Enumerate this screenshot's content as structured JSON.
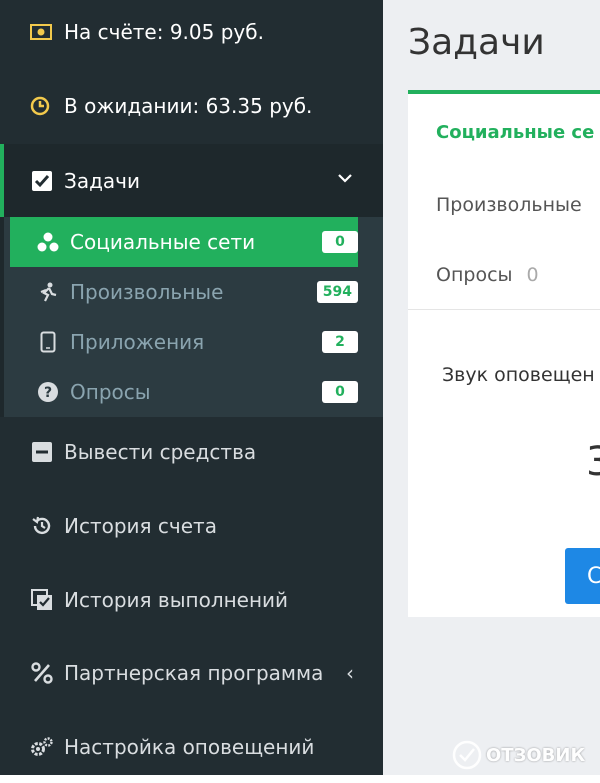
{
  "sidebar": {
    "balance": "На счёте: 9.05 руб.",
    "pending": "В ожидании: 63.35 руб.",
    "tasks_label": "Задачи",
    "submenu": [
      {
        "label": "Социальные сети",
        "badge": "0",
        "icon": "social-icon"
      },
      {
        "label": "Произвольные",
        "badge": "594",
        "icon": "custom-icon"
      },
      {
        "label": "Приложения",
        "badge": "2",
        "icon": "phone-icon"
      },
      {
        "label": "Опросы",
        "badge": "0",
        "icon": "question-icon"
      }
    ],
    "nav": [
      {
        "label": "Вывести средства",
        "icon": "minus-square-icon"
      },
      {
        "label": "История счета",
        "icon": "history-icon"
      },
      {
        "label": "История выполнений",
        "icon": "checked-list-icon"
      },
      {
        "label": "Партнерская программа",
        "icon": "percent-icon",
        "arrow": "‹"
      },
      {
        "label": "Настройка оповещений",
        "icon": "gears-icon"
      }
    ]
  },
  "main": {
    "title": "Задачи",
    "box_title": "Социальные се",
    "row1_label": "Произвольные",
    "row2_label": "Опросы",
    "row2_count": "0",
    "sound_label": "Звук оповещен",
    "big_char": "3",
    "button_label": "С"
  },
  "watermark": "ОТЗОВИК",
  "colors": {
    "accent": "#22b05d",
    "sidebar": "#222d32",
    "submenu": "#2c3b41",
    "button": "#1e88e5"
  }
}
